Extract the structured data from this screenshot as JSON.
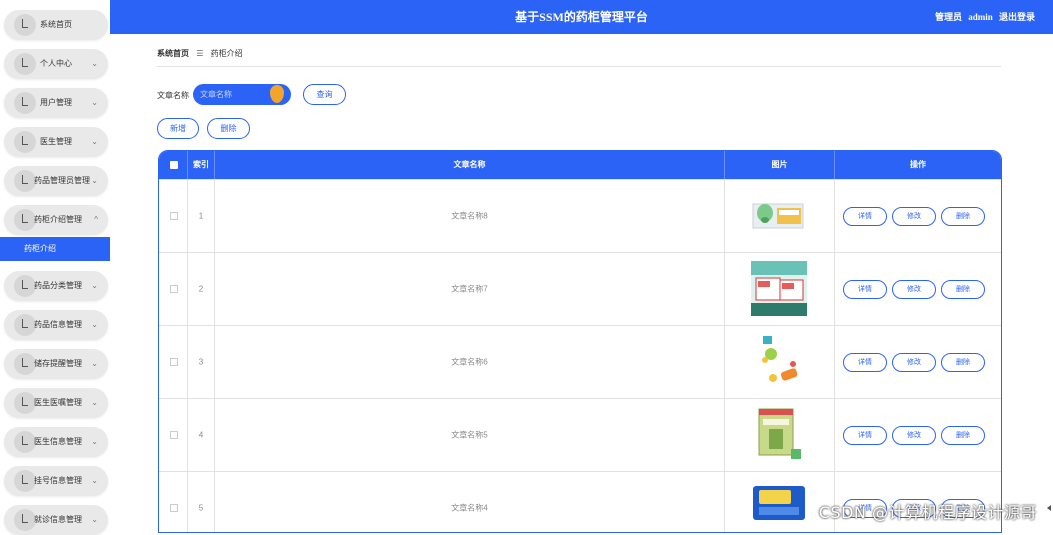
{
  "header": {
    "title": "基于SSM的药柜管理平台",
    "user_role": "管理员",
    "user_name": "admin",
    "logout": "退出登录"
  },
  "sidebar": {
    "items": [
      {
        "label": "系统首页",
        "has_chevron": false
      },
      {
        "label": "个人中心",
        "has_chevron": true
      },
      {
        "label": "用户管理",
        "has_chevron": true
      },
      {
        "label": "医生管理",
        "has_chevron": true
      },
      {
        "label": "药品管理员管理",
        "has_chevron": true
      },
      {
        "label": "药柜介绍管理",
        "has_chevron": true,
        "expanded": true
      },
      {
        "label": "药品分类管理",
        "has_chevron": true
      },
      {
        "label": "药品信息管理",
        "has_chevron": true
      },
      {
        "label": "储存提醒管理",
        "has_chevron": true
      },
      {
        "label": "医生医嘱管理",
        "has_chevron": true
      },
      {
        "label": "医生信息管理",
        "has_chevron": true
      },
      {
        "label": "挂号信息管理",
        "has_chevron": true
      },
      {
        "label": "就诊信息管理",
        "has_chevron": true
      }
    ],
    "active_sub": "药柜介绍",
    "chevron_down": "⌄",
    "chevron_up": "^"
  },
  "breadcrumb": {
    "home": "系统首页",
    "separator": "☰",
    "current": "药柜介绍"
  },
  "search": {
    "label": "文章名称",
    "placeholder": "文章名称",
    "query_button": "查询"
  },
  "toolbar": {
    "add": "新增",
    "delete": "删除"
  },
  "table": {
    "columns": [
      "索引",
      "文章名称",
      "图片",
      "操作"
    ],
    "rows": [
      {
        "index": "1",
        "name": "文章名称8"
      },
      {
        "index": "2",
        "name": "文章名称7"
      },
      {
        "index": "3",
        "name": "文章名称6"
      },
      {
        "index": "4",
        "name": "文章名称5"
      },
      {
        "index": "5",
        "name": "文章名称4"
      }
    ],
    "actions": [
      "详情",
      "修改",
      "删除"
    ]
  },
  "watermark": "CSDN @计算机程序设计源哥",
  "colors": {
    "primary": "#2b63f6",
    "sidebar_item": "#e9e9e9"
  }
}
